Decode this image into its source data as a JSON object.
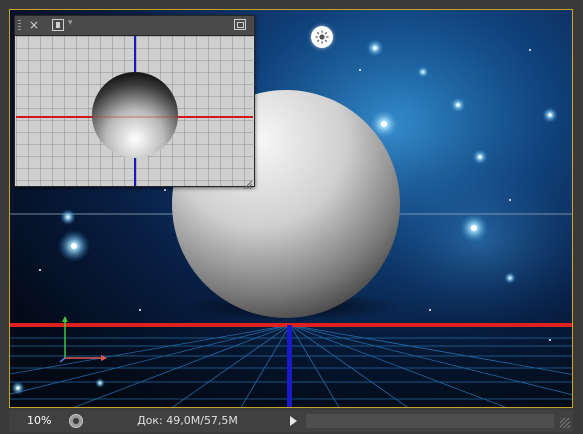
{
  "preview_panel": {
    "close_glyph": "×",
    "dropdown_glyph": "▾",
    "icons": [
      "close-icon",
      "export-icon",
      "chevron-down-icon",
      "fit-view-icon",
      "resize-grip-icon"
    ]
  },
  "status_bar": {
    "zoom": "10%",
    "doc_info": "Док: 49,0M/57,5M"
  },
  "scene": {
    "light_icon": "sun-icon",
    "colors": {
      "frame_border": "#c9a227",
      "x_axis": "#e0201e",
      "z_axis": "#1a1ac8",
      "y_gizmo": "#3cc83c",
      "x_gizmo": "#e05a5a",
      "sphere_light": "#f2f2f2",
      "sphere_dark": "#3c3c3c",
      "background_mid": "#1d6fb0",
      "background_dark": "#030a18"
    }
  }
}
